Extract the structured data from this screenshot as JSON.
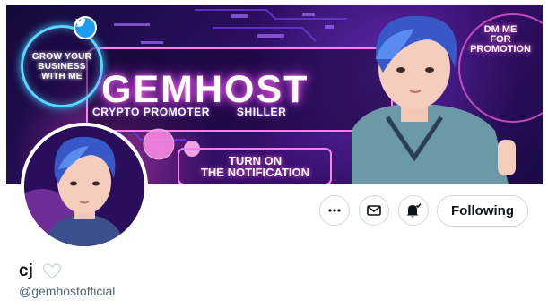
{
  "banner": {
    "badge_text": "GROW YOUR\nBUSINESS\nWITH ME",
    "brand": "GEMHOST",
    "tagline_left": "CRYPTO PROMOTER",
    "tagline_right": "SHILLER",
    "notify": "TURN ON\nTHE NOTIFICATION",
    "dm": "DM ME\nFOR\nPROMOTION",
    "colors": {
      "neon_pink": "#ff63e6",
      "neon_blue": "#5ad7ff",
      "bg_purple": "#2a0e5c"
    }
  },
  "actions": {
    "more_icon": "more-dots-icon",
    "message_icon": "envelope-icon",
    "notify_icon": "bell-check-icon",
    "follow_label": "Following"
  },
  "profile": {
    "name": "cj",
    "name_emoji": "white-heart",
    "handle": "@gemhostofficial"
  },
  "colors": {
    "text_primary": "#0f1419",
    "text_secondary": "#536471",
    "border": "#cfd9de"
  }
}
